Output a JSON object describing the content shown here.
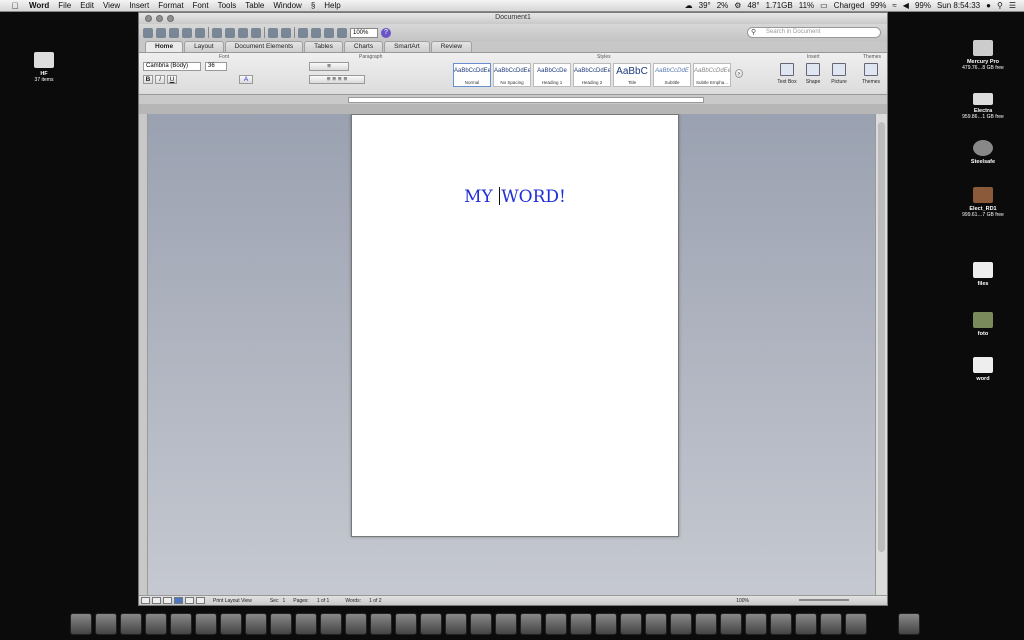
{
  "menubar": {
    "app": "Word",
    "items": [
      "File",
      "Edit",
      "View",
      "Insert",
      "Format",
      "Font",
      "Tools",
      "Table",
      "Window",
      "Help"
    ],
    "status": {
      "temp": "39°",
      "cpu": "2%",
      "temp2": "48°",
      "disk": "1.71GB",
      "battery_pct": "11%",
      "battery_state": "Charged",
      "battery_level": "99%",
      "volume": "99%",
      "clock": "Sun 8:54:33"
    }
  },
  "desktop": {
    "icons_left": [
      {
        "name": "HF",
        "sub": "37 items"
      }
    ],
    "icons_right": [
      {
        "name": "Mercury Pro",
        "sub": "479.76…8 GB free"
      },
      {
        "name": "Electra",
        "sub": "959.86…1 GB free"
      },
      {
        "name": "Steelsafe",
        "sub": ""
      },
      {
        "name": "Elect_RD1",
        "sub": "999.61…7 GB free"
      },
      {
        "name": "files",
        "sub": ""
      },
      {
        "name": "foto",
        "sub": ""
      },
      {
        "name": "word",
        "sub": ""
      }
    ]
  },
  "window": {
    "title": "Document1",
    "zoom": "100%",
    "search_placeholder": "Search in Document",
    "tabs": [
      "Home",
      "Layout",
      "Document Elements",
      "Tables",
      "Charts",
      "SmartArt",
      "Review"
    ],
    "active_tab": "Home",
    "groups": {
      "font": "Font",
      "paragraph": "Paragraph",
      "styles": "Styles",
      "insert": "Insert",
      "themes": "Themes"
    },
    "font_name": "Cambria (Body)",
    "font_size": "36",
    "styles": [
      {
        "preview": "AaBbCcDdEe",
        "name": "Normal"
      },
      {
        "preview": "AaBbCcDdEe",
        "name": "No Spacing"
      },
      {
        "preview": "AaBbCcDe",
        "name": "Heading 1"
      },
      {
        "preview": "AaBbCcDdEe",
        "name": "Heading 2"
      },
      {
        "preview": "AaBbC",
        "name": "Title"
      },
      {
        "preview": "AaBbCcDdE",
        "name": "Subtitle"
      },
      {
        "preview": "AaBbCcDdEe",
        "name": "Subtle Empha..."
      }
    ],
    "insert_items": [
      "Text Box",
      "Shape",
      "Picture"
    ],
    "themes_label": "Themes",
    "document_text_left": "MY ",
    "document_text_right": "WORD!",
    "status": {
      "view": "Print Layout View",
      "sec_label": "Sec",
      "sec": "1",
      "pages_label": "Pages:",
      "pages": "1 of 1",
      "words_label": "Words:",
      "words": "1 of 2",
      "zoom": "100%"
    }
  },
  "colors": {
    "doc_text": "#1f2fd6",
    "desktop": "#0b0b0b"
  }
}
